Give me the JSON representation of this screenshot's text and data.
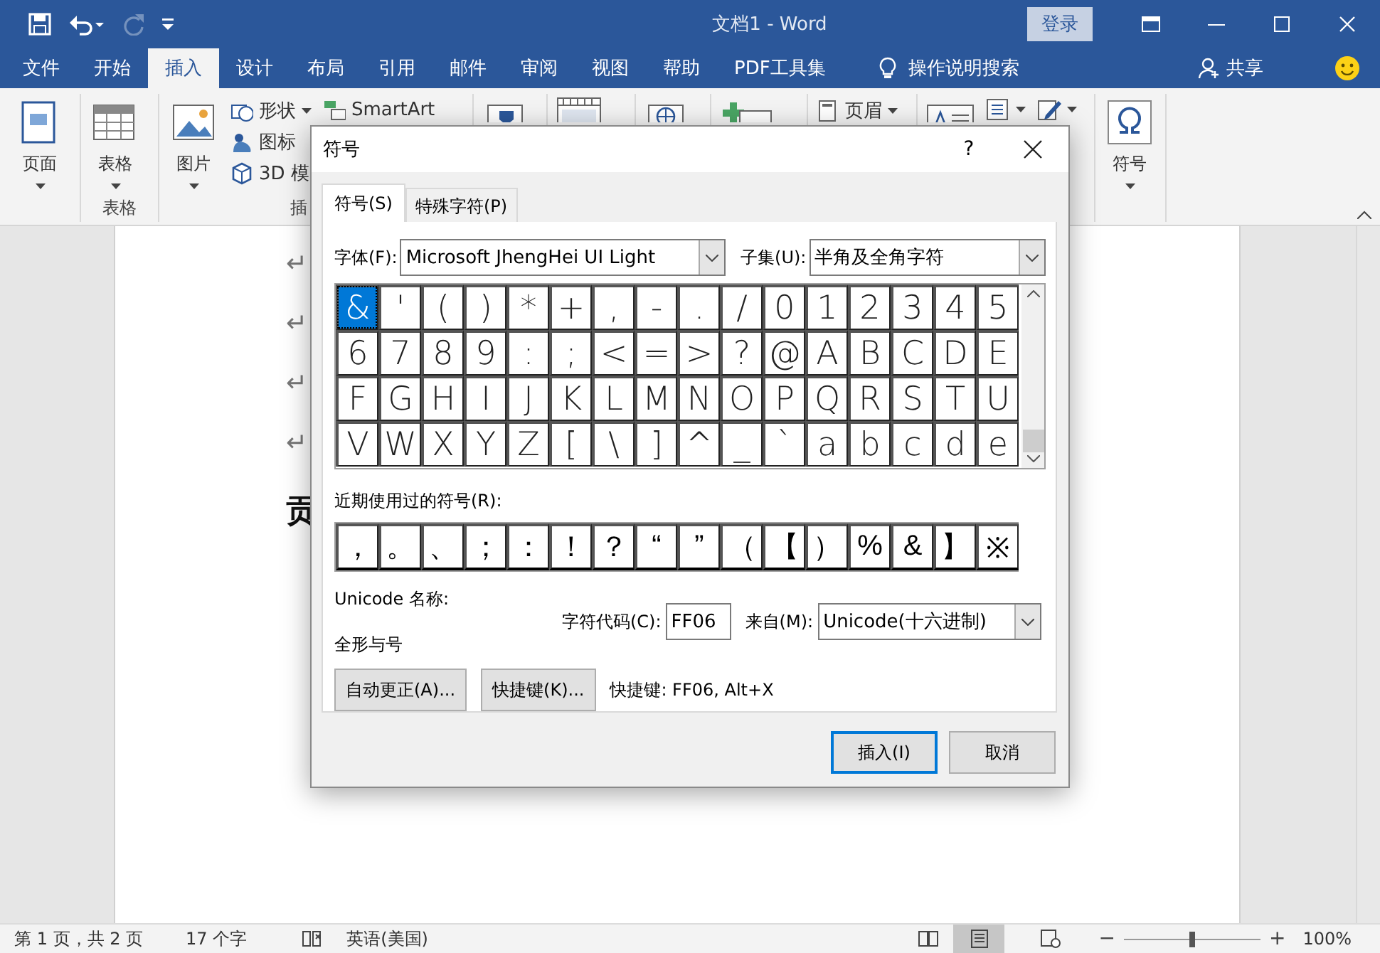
{
  "title_bar": {
    "title": "文档1 - Word",
    "sign_in": "登录",
    "redo_disabled": true
  },
  "ribbon_tabs": [
    {
      "label": "文件",
      "selected": false
    },
    {
      "label": "开始",
      "selected": false
    },
    {
      "label": "插入",
      "selected": true
    },
    {
      "label": "设计",
      "selected": false
    },
    {
      "label": "布局",
      "selected": false
    },
    {
      "label": "引用",
      "selected": false
    },
    {
      "label": "邮件",
      "selected": false
    },
    {
      "label": "审阅",
      "selected": false
    },
    {
      "label": "视图",
      "selected": false
    },
    {
      "label": "帮助",
      "selected": false
    },
    {
      "label": "PDF工具集",
      "selected": false
    }
  ],
  "tell_me": "操作说明搜索",
  "share": "共享",
  "ribbon": {
    "groups": [
      {
        "buttons": [
          {
            "kind": "large",
            "label": "页面",
            "caret": true
          }
        ]
      },
      {
        "label": "表格",
        "buttons": [
          {
            "kind": "large",
            "label": "表格",
            "caret": true
          }
        ]
      },
      {
        "label": "插",
        "buttons": [
          {
            "kind": "large",
            "label": "图片",
            "caret": true
          },
          {
            "kind": "small",
            "label": "形状",
            "caret": true
          },
          {
            "kind": "small",
            "label": "图标",
            "caret": false
          },
          {
            "kind": "small",
            "label": "3D 模",
            "caret": false
          },
          {
            "kind": "small",
            "label": "SmartArt",
            "caret": false
          }
        ]
      },
      {
        "buttons": [
          {
            "kind": "icon",
            "caret": false
          }
        ]
      },
      {
        "buttons": [
          {
            "kind": "icon",
            "caret": false
          }
        ]
      },
      {
        "buttons": [
          {
            "kind": "icon",
            "caret": false
          }
        ]
      },
      {
        "buttons": [
          {
            "kind": "icon",
            "caret": false
          }
        ]
      },
      {
        "buttons": [
          {
            "kind": "small",
            "label": "页眉",
            "caret": true
          }
        ]
      },
      {
        "buttons": [
          {
            "kind": "icon",
            "caret": false
          },
          {
            "kind": "icon",
            "caret": true
          },
          {
            "kind": "icon",
            "caret": true
          }
        ]
      },
      {
        "buttons": [
          {
            "kind": "large",
            "label": "符号",
            "caret": true
          }
        ]
      }
    ]
  },
  "document": {
    "marks": [
      "↵",
      "↵",
      "↵",
      "↵"
    ],
    "text": "贡"
  },
  "dialog": {
    "title": "符号",
    "help": "?",
    "tabs": [
      {
        "label": "符号(S)",
        "selected": true
      },
      {
        "label": "特殊字符(P)",
        "selected": false
      }
    ],
    "font_label": "字体(F):",
    "font": "Microsoft JhengHei UI Light",
    "subset_label": "子集(U):",
    "subset": "半角及全角字符",
    "symbols": [
      {
        "char": "&",
        "selected": true
      },
      {
        "char": "'",
        "selected": false
      },
      {
        "char": "(",
        "selected": false
      },
      {
        "char": ")",
        "selected": false
      },
      {
        "char": "*",
        "selected": false
      },
      {
        "char": "+",
        "selected": false
      },
      {
        "char": ",",
        "selected": false
      },
      {
        "char": "-",
        "selected": false
      },
      {
        "char": ".",
        "selected": false
      },
      {
        "char": "/",
        "selected": false
      },
      {
        "char": "0",
        "selected": false
      },
      {
        "char": "1",
        "selected": false
      },
      {
        "char": "2",
        "selected": false
      },
      {
        "char": "3",
        "selected": false
      },
      {
        "char": "4",
        "selected": false
      },
      {
        "char": "5",
        "selected": false
      },
      {
        "char": "6",
        "selected": false
      },
      {
        "char": "7",
        "selected": false
      },
      {
        "char": "8",
        "selected": false
      },
      {
        "char": "9",
        "selected": false
      },
      {
        "char": ":",
        "selected": false
      },
      {
        "char": ";",
        "selected": false
      },
      {
        "char": "<",
        "selected": false
      },
      {
        "char": "=",
        "selected": false
      },
      {
        "char": ">",
        "selected": false
      },
      {
        "char": "?",
        "selected": false
      },
      {
        "char": "@",
        "selected": false
      },
      {
        "char": "A",
        "selected": false
      },
      {
        "char": "B",
        "selected": false
      },
      {
        "char": "C",
        "selected": false
      },
      {
        "char": "D",
        "selected": false
      },
      {
        "char": "E",
        "selected": false
      },
      {
        "char": "F",
        "selected": false
      },
      {
        "char": "G",
        "selected": false
      },
      {
        "char": "H",
        "selected": false
      },
      {
        "char": "I",
        "selected": false
      },
      {
        "char": "J",
        "selected": false
      },
      {
        "char": "K",
        "selected": false
      },
      {
        "char": "L",
        "selected": false
      },
      {
        "char": "M",
        "selected": false
      },
      {
        "char": "N",
        "selected": false
      },
      {
        "char": "O",
        "selected": false
      },
      {
        "char": "P",
        "selected": false
      },
      {
        "char": "Q",
        "selected": false
      },
      {
        "char": "R",
        "selected": false
      },
      {
        "char": "S",
        "selected": false
      },
      {
        "char": "T",
        "selected": false
      },
      {
        "char": "U",
        "selected": false
      },
      {
        "char": "V",
        "selected": false
      },
      {
        "char": "W",
        "selected": false
      },
      {
        "char": "X",
        "selected": false
      },
      {
        "char": "Y",
        "selected": false
      },
      {
        "char": "Z",
        "selected": false
      },
      {
        "char": "[",
        "selected": false
      },
      {
        "char": "\\",
        "selected": false
      },
      {
        "char": "]",
        "selected": false
      },
      {
        "char": "^",
        "selected": false
      },
      {
        "char": "_",
        "selected": false
      },
      {
        "char": "`",
        "selected": false
      },
      {
        "char": "a",
        "selected": false
      },
      {
        "char": "b",
        "selected": false
      },
      {
        "char": "c",
        "selected": false
      },
      {
        "char": "d",
        "selected": false
      },
      {
        "char": "e",
        "selected": false
      }
    ],
    "recent_label": "近期使用过的符号(R):",
    "recent": [
      "，",
      "。",
      "、",
      "；",
      "：",
      "！",
      "？",
      "“",
      "”",
      "（",
      "【",
      "）",
      "%",
      "&",
      "】",
      "※"
    ],
    "unicode_name_label": "Unicode 名称:",
    "unicode_name": "全形与号",
    "code_label": "字符代码(C):",
    "code": "FF06",
    "from_label": "来自(M):",
    "from": "Unicode(十六进制)",
    "autocorrect": "自动更正(A)...",
    "shortcut_key": "快捷键(K)...",
    "shortcut_info": "快捷键: FF06, Alt+X",
    "insert": "插入(I)",
    "cancel": "取消"
  },
  "status_bar": {
    "page": "第 1 页，共 2 页",
    "words": "17 个字",
    "language": "英语(美国)",
    "views": [
      {
        "selected": false
      },
      {
        "selected": true
      },
      {
        "selected": false
      }
    ],
    "zoom_out": "−",
    "zoom_in": "+",
    "zoom": {
      "level": 0.5
    },
    "zoom_percent": "100%"
  }
}
